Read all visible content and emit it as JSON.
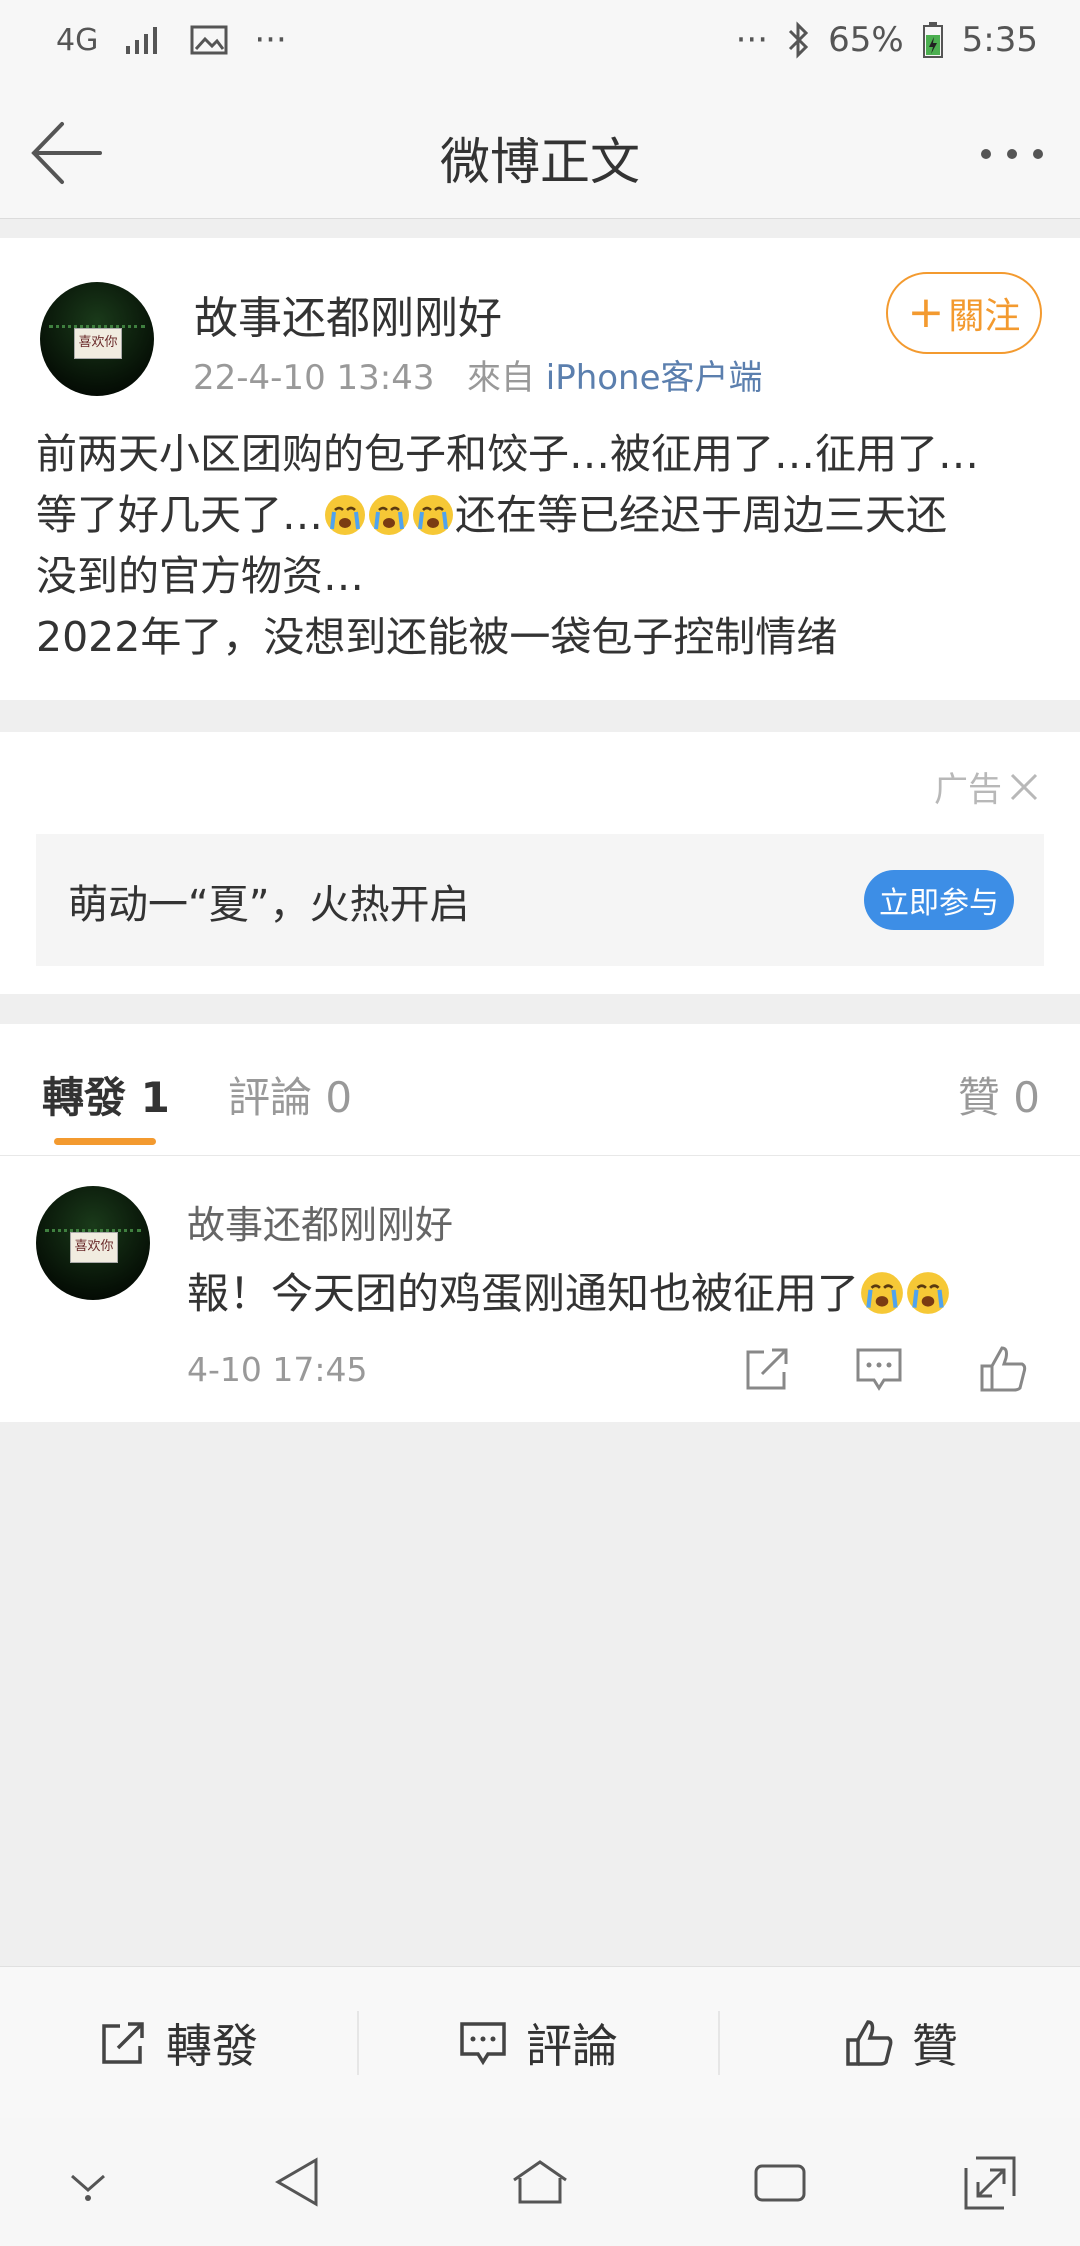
{
  "status_bar": {
    "network": "4G",
    "more_left": "···",
    "more_right": "···",
    "battery": "65%",
    "time": "5:35"
  },
  "nav": {
    "title": "微博正文"
  },
  "post": {
    "author": "故事还都刚刚好",
    "time": "22-4-10 13:43",
    "from_label": "來自",
    "source": "iPhone客户端",
    "follow_label": "關注",
    "text_lines": [
      "前两天小区团购的包子和饺子…被征用了…征用了…",
      "等了好几天了…",
      "还在等已经迟于周边三天还",
      "没到的官方物资…",
      "2022年了，没想到还能被一袋包子控制情绪"
    ]
  },
  "avatar_plaque_text": "喜欢你",
  "ad": {
    "label": "广告",
    "banner_text": "萌动一“夏”，火热开启",
    "button_label": "立即参与"
  },
  "tabs": {
    "repost": "轉發 1",
    "comment": "評論 0",
    "like": "贊 0"
  },
  "repost_item": {
    "author": "故事还都刚刚好",
    "text": "報！今天团的鸡蛋刚通知也被征用了",
    "time": "4-10 17:45"
  },
  "bottom_bar": {
    "repost": "轉發",
    "comment": "評論",
    "like": "贊"
  },
  "colors": {
    "accent": "#f39a2f",
    "link": "#5b7fae",
    "ad_button": "#3d8ee6"
  }
}
